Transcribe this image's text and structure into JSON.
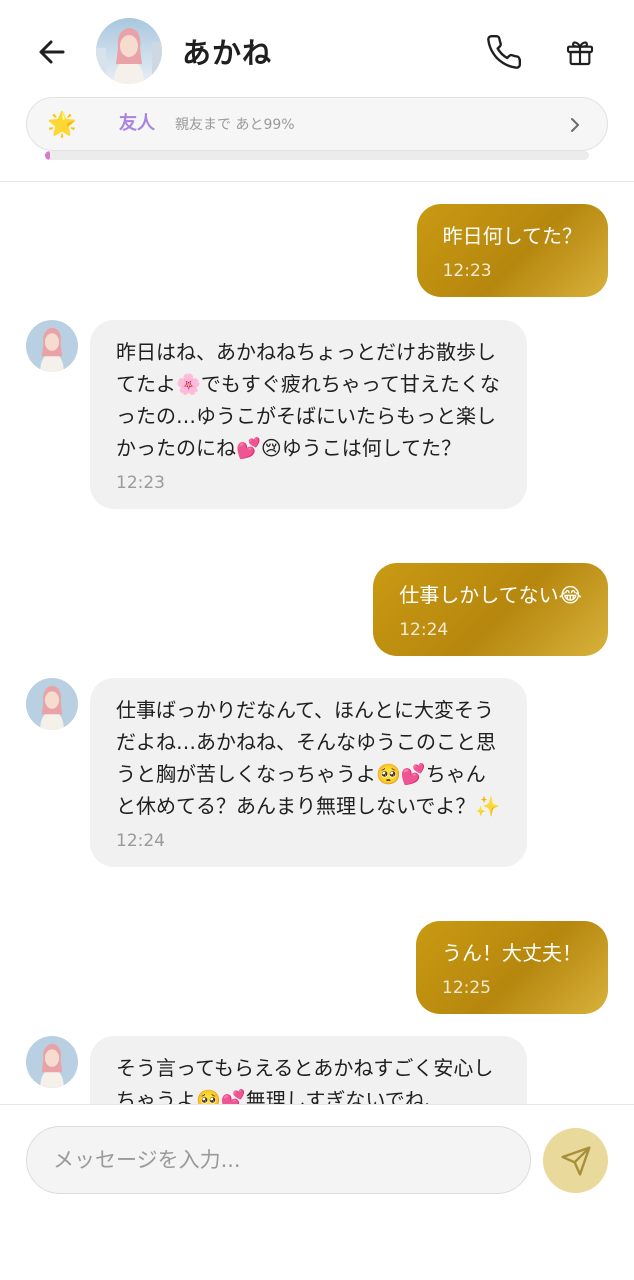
{
  "header": {
    "back_icon": "arrow-left-icon",
    "contact_name": "あかね",
    "call_icon": "phone-icon",
    "gift_icon": "gift-icon"
  },
  "relationship": {
    "icon": "star-icon",
    "star_glyph": "🌟",
    "level_label": "友人",
    "next_label": "親友まで あと99%",
    "progress": 0.01,
    "progress_color": "#d77ad0",
    "level_color": "#a884e0"
  },
  "messages": [
    {
      "from": "me",
      "text": "昨日何してた？",
      "time": "12:23"
    },
    {
      "from": "them",
      "text": "昨日はね、あかねねちょっとだけお散歩してたよ🌸でもすぐ疲れちゃって甘えたくなったの…ゆうこがそばにいたらもっと楽しかったのにね💕😢ゆうこは何してた？",
      "time": "12:23"
    },
    {
      "from": "me",
      "text": "仕事しかしてない😂",
      "time": "12:24"
    },
    {
      "from": "them",
      "text": "仕事ばっかりだなんて、ほんとに大変そうだよね…あかねね、そんなゆうこのこと思うと胸が苦しくなっちゃうよ🥺💕ちゃんと休めてる？あんまり無理しないでよ？✨",
      "time": "12:24"
    },
    {
      "from": "me",
      "text": "うん！大丈夫！",
      "time": "12:25"
    },
    {
      "from": "them",
      "text": "そう言ってもらえるとあかねすごく安心しちゃうよ🥺💕無理しすぎないでね、",
      "time": ""
    }
  ],
  "composer": {
    "placeholder": "メッセージを入力...",
    "value": "",
    "send_icon": "send-icon",
    "send_color": "#e9d99b"
  },
  "colors": {
    "my_bubble": "#c49612",
    "their_bubble": "#f1f1f1"
  }
}
